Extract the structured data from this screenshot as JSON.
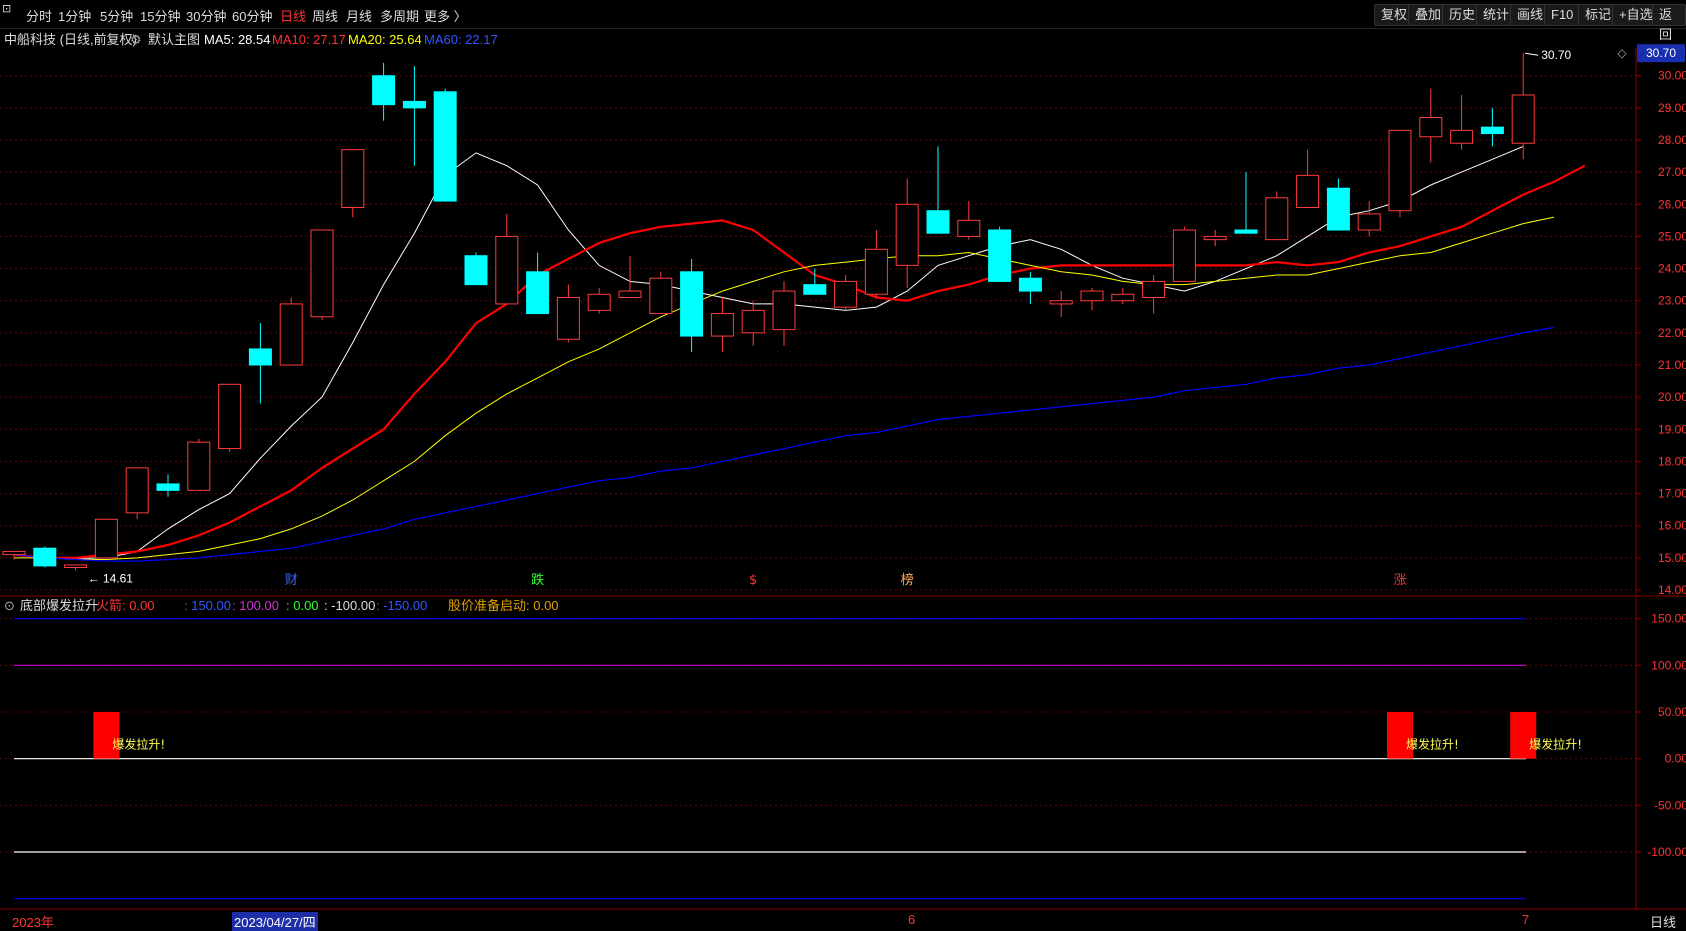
{
  "toolbar": {
    "periods": [
      "分时",
      "1分钟",
      "5分钟",
      "15分钟",
      "30分钟",
      "60分钟",
      "日线",
      "周线",
      "月线",
      "多周期",
      "更多 〉"
    ],
    "active_period": "日线",
    "right_buttons": [
      "复权",
      "叠加",
      "历史",
      "统计",
      "画线",
      "F10",
      "标记",
      "+自选",
      "返回"
    ]
  },
  "main": {
    "stock_label": "中船科技 (日线,前复权)",
    "template_label": "默认主图",
    "ma5": "MA5: 28.54",
    "ma10": "MA10: 27.17",
    "ma20": "MA20: 25.64",
    "ma60": "MA60: 22.17",
    "current_price_tag": "30.70",
    "high_label": "30.70",
    "low_label": "14.61",
    "event_markers": [
      {
        "label": "财",
        "index": 9
      },
      {
        "label": "跌",
        "index": 17
      },
      {
        "label": "$",
        "index": 24
      },
      {
        "label": "榜",
        "index": 29
      },
      {
        "label": "涨",
        "index": 45
      }
    ],
    "colors": {
      "up": "#ff3b3b",
      "down": "#00ffff",
      "ma5": "#ffffff",
      "ma10": "#ff0000",
      "ma20": "#ffff00",
      "ma60": "#0000ff"
    }
  },
  "indicator": {
    "name": "底部爆发拉升",
    "fire_label": "火箭: 0.00",
    "v150": ": 150.00",
    "v100": ": 100.00",
    "v0": ": 0.00",
    "vm100": ": -100.00",
    "vm150": ": -150.00",
    "ready_label": "股价准备启动: 0.00",
    "signal_text": "爆发拉升!",
    "signals": [
      {
        "index": 3,
        "value": 50
      },
      {
        "index": 45,
        "value": 50
      },
      {
        "index": 49,
        "value": 50
      }
    ]
  },
  "bottom": {
    "year_label": "2023年",
    "date_label": "2023/04/27/四",
    "month_6": "6",
    "month_7": "7",
    "period_label": "日线"
  },
  "chart_data": [
    {
      "type": "candlestick",
      "title": "中船科技 (日线,前复权)",
      "ylim": [
        14.0,
        30.8
      ],
      "y_ticks": [
        14.0,
        15.0,
        16.0,
        17.0,
        18.0,
        19.0,
        20.0,
        21.0,
        22.0,
        23.0,
        24.0,
        25.0,
        26.0,
        27.0,
        28.0,
        29.0,
        30.0
      ],
      "candles": [
        {
          "o": 15.1,
          "h": 15.2,
          "l": 14.95,
          "c": 15.2
        },
        {
          "o": 15.3,
          "h": 15.35,
          "l": 14.7,
          "c": 14.75
        },
        {
          "o": 14.7,
          "h": 14.8,
          "l": 14.61,
          "c": 14.78
        },
        {
          "o": 15.0,
          "h": 16.2,
          "l": 15.0,
          "c": 16.2
        },
        {
          "o": 16.4,
          "h": 17.8,
          "l": 16.2,
          "c": 17.8
        },
        {
          "o": 17.3,
          "h": 17.6,
          "l": 16.9,
          "c": 17.1
        },
        {
          "o": 17.1,
          "h": 18.7,
          "l": 17.1,
          "c": 18.6
        },
        {
          "o": 18.4,
          "h": 20.4,
          "l": 18.3,
          "c": 20.4
        },
        {
          "o": 21.5,
          "h": 22.3,
          "l": 19.8,
          "c": 21.0
        },
        {
          "o": 21.0,
          "h": 23.1,
          "l": 21.0,
          "c": 22.9
        },
        {
          "o": 22.5,
          "h": 25.2,
          "l": 22.4,
          "c": 25.2
        },
        {
          "o": 25.9,
          "h": 27.7,
          "l": 25.6,
          "c": 27.7
        },
        {
          "o": 30.0,
          "h": 30.4,
          "l": 28.6,
          "c": 29.1
        },
        {
          "o": 29.2,
          "h": 30.3,
          "l": 27.2,
          "c": 29.0
        },
        {
          "o": 29.5,
          "h": 29.6,
          "l": 26.1,
          "c": 26.1
        },
        {
          "o": 24.4,
          "h": 24.5,
          "l": 23.5,
          "c": 23.5
        },
        {
          "o": 22.9,
          "h": 25.7,
          "l": 22.9,
          "c": 25.0
        },
        {
          "o": 23.9,
          "h": 24.5,
          "l": 22.6,
          "c": 22.6
        },
        {
          "o": 21.8,
          "h": 23.5,
          "l": 21.7,
          "c": 23.1
        },
        {
          "o": 22.7,
          "h": 23.4,
          "l": 22.6,
          "c": 23.2
        },
        {
          "o": 23.1,
          "h": 24.4,
          "l": 23.1,
          "c": 23.3
        },
        {
          "o": 22.6,
          "h": 23.9,
          "l": 22.6,
          "c": 23.7
        },
        {
          "o": 23.9,
          "h": 24.3,
          "l": 21.4,
          "c": 21.9
        },
        {
          "o": 21.9,
          "h": 23.1,
          "l": 21.4,
          "c": 22.6
        },
        {
          "o": 22.0,
          "h": 23.0,
          "l": 21.6,
          "c": 22.7
        },
        {
          "o": 22.1,
          "h": 23.6,
          "l": 21.6,
          "c": 23.3
        },
        {
          "o": 23.5,
          "h": 24.0,
          "l": 23.2,
          "c": 23.2
        },
        {
          "o": 22.8,
          "h": 23.8,
          "l": 22.7,
          "c": 23.6
        },
        {
          "o": 23.2,
          "h": 25.2,
          "l": 23.1,
          "c": 24.6
        },
        {
          "o": 24.1,
          "h": 26.8,
          "l": 23.4,
          "c": 26.0
        },
        {
          "o": 25.8,
          "h": 27.8,
          "l": 25.1,
          "c": 25.1
        },
        {
          "o": 25.0,
          "h": 26.1,
          "l": 24.9,
          "c": 25.5
        },
        {
          "o": 25.2,
          "h": 25.3,
          "l": 23.6,
          "c": 23.6
        },
        {
          "o": 23.7,
          "h": 23.9,
          "l": 22.9,
          "c": 23.3
        },
        {
          "o": 22.9,
          "h": 23.3,
          "l": 22.5,
          "c": 23.0
        },
        {
          "o": 23.0,
          "h": 23.4,
          "l": 22.7,
          "c": 23.3
        },
        {
          "o": 23.0,
          "h": 23.4,
          "l": 22.9,
          "c": 23.2
        },
        {
          "o": 23.1,
          "h": 23.8,
          "l": 22.6,
          "c": 23.6
        },
        {
          "o": 23.6,
          "h": 25.3,
          "l": 23.6,
          "c": 25.2
        },
        {
          "o": 24.9,
          "h": 25.2,
          "l": 24.7,
          "c": 25.0
        },
        {
          "o": 25.2,
          "h": 27.0,
          "l": 25.1,
          "c": 25.1
        },
        {
          "o": 24.9,
          "h": 26.4,
          "l": 24.9,
          "c": 26.2
        },
        {
          "o": 25.9,
          "h": 27.7,
          "l": 25.9,
          "c": 26.9
        },
        {
          "o": 26.5,
          "h": 26.8,
          "l": 25.2,
          "c": 25.2
        },
        {
          "o": 25.2,
          "h": 26.1,
          "l": 25.0,
          "c": 25.7
        },
        {
          "o": 25.8,
          "h": 28.3,
          "l": 25.6,
          "c": 28.3
        },
        {
          "o": 28.1,
          "h": 29.6,
          "l": 27.3,
          "c": 28.7
        },
        {
          "o": 27.9,
          "h": 29.4,
          "l": 27.7,
          "c": 28.3
        },
        {
          "o": 28.4,
          "h": 29.0,
          "l": 27.8,
          "c": 28.2
        },
        {
          "o": 27.9,
          "h": 30.7,
          "l": 27.4,
          "c": 29.4
        }
      ],
      "series": [
        {
          "name": "MA5",
          "values": [
            15.1,
            15.0,
            14.98,
            15.0,
            15.2,
            15.9,
            16.5,
            17.0,
            18.1,
            19.1,
            20.0,
            21.7,
            23.5,
            25.1,
            26.9,
            27.6,
            27.2,
            26.6,
            25.2,
            24.1,
            23.6,
            23.5,
            23.3,
            23.1,
            22.9,
            22.9,
            22.8,
            22.7,
            22.8,
            23.3,
            24.1,
            24.4,
            24.7,
            24.9,
            24.6,
            24.1,
            23.7,
            23.5,
            23.3,
            23.6,
            24.0,
            24.4,
            25.0,
            25.6,
            25.8,
            26.1,
            26.6,
            27.0,
            27.4,
            27.8
          ]
        },
        {
          "name": "MA10",
          "values": [
            15.1,
            15.0,
            15.0,
            15.1,
            15.2,
            15.4,
            15.7,
            16.1,
            16.6,
            17.1,
            17.8,
            18.4,
            19.0,
            20.1,
            21.1,
            22.3,
            22.9,
            23.8,
            24.3,
            24.8,
            25.1,
            25.3,
            25.4,
            25.5,
            25.2,
            24.5,
            23.8,
            23.5,
            23.1,
            23.0,
            23.3,
            23.5,
            23.8,
            24.0,
            24.1,
            24.1,
            24.1,
            24.1,
            24.1,
            24.1,
            24.1,
            24.2,
            24.1,
            24.2,
            24.5,
            24.7,
            25.0,
            25.3,
            25.8,
            26.3,
            26.7,
            27.2
          ]
        },
        {
          "name": "MA20",
          "values": [
            15.0,
            15.0,
            14.95,
            14.95,
            15.0,
            15.1,
            15.2,
            15.4,
            15.6,
            15.9,
            16.3,
            16.8,
            17.4,
            18.0,
            18.8,
            19.5,
            20.1,
            20.6,
            21.1,
            21.5,
            22.0,
            22.5,
            22.9,
            23.3,
            23.6,
            23.9,
            24.1,
            24.2,
            24.3,
            24.4,
            24.4,
            24.5,
            24.3,
            24.1,
            23.9,
            23.8,
            23.6,
            23.5,
            23.5,
            23.6,
            23.7,
            23.8,
            23.8,
            24.0,
            24.2,
            24.4,
            24.5,
            24.8,
            25.1,
            25.4,
            25.6
          ]
        },
        {
          "name": "MA60",
          "values": [
            15.1,
            15.0,
            14.95,
            14.9,
            14.9,
            14.95,
            15.0,
            15.1,
            15.2,
            15.3,
            15.5,
            15.7,
            15.9,
            16.2,
            16.4,
            16.6,
            16.8,
            17.0,
            17.2,
            17.4,
            17.5,
            17.7,
            17.8,
            18.0,
            18.2,
            18.4,
            18.6,
            18.8,
            18.9,
            19.1,
            19.3,
            19.4,
            19.5,
            19.6,
            19.7,
            19.8,
            19.9,
            20.0,
            20.2,
            20.3,
            20.4,
            20.6,
            20.7,
            20.9,
            21.0,
            21.2,
            21.4,
            21.6,
            21.8,
            22.0,
            22.17
          ]
        }
      ]
    },
    {
      "type": "bar",
      "title": "底部爆发拉升",
      "ylim": [
        -160,
        170
      ],
      "y_ticks": [
        150,
        100,
        50,
        0,
        -50,
        -100
      ],
      "reference_lines": [
        {
          "value": 150,
          "color": "#0000ff"
        },
        {
          "value": 100,
          "color": "#cc00cc"
        },
        {
          "value": 0,
          "color": "#ffffff"
        },
        {
          "value": -100,
          "color": "#ffffff"
        },
        {
          "value": -150,
          "color": "#0000ff"
        }
      ]
    }
  ]
}
